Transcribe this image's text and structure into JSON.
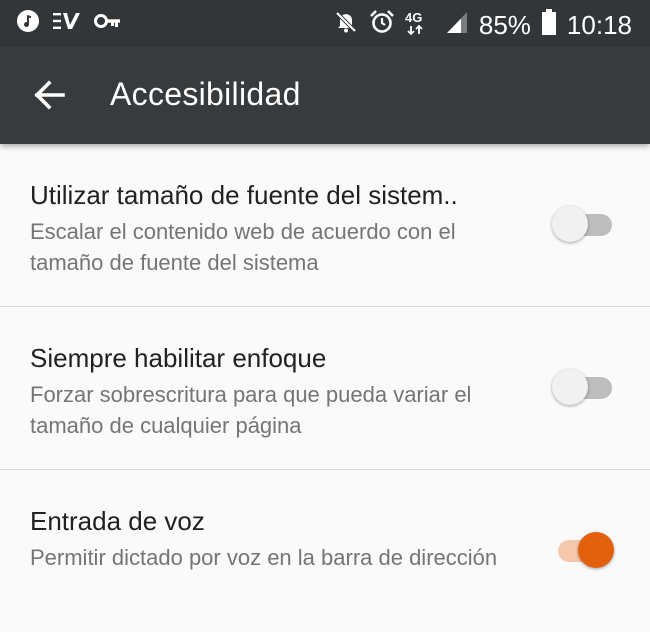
{
  "status_bar": {
    "battery_text": "85%",
    "time": "10:18",
    "network": "4G",
    "left_icons": [
      "music-icon",
      "ev-icon",
      "key-icon"
    ],
    "right_icons": [
      "mute-icon",
      "alarm-icon",
      "network-icon",
      "signal-icon",
      "battery-icon"
    ]
  },
  "app_bar": {
    "title": "Accesibilidad",
    "back_icon": "back-arrow-icon"
  },
  "settings": [
    {
      "title": "Utilizar tamaño de fuente del sistem..",
      "summary": "Escalar el contenido web de acuerdo con el tamaño de fuente del sistema",
      "enabled": false
    },
    {
      "title": "Siempre habilitar enfoque",
      "summary": "Forzar sobrescritura para que pueda variar el tamaño de cualquier página",
      "enabled": false
    },
    {
      "title": "Entrada de voz",
      "summary": "Permitir dictado por voz en la barra de dirección",
      "enabled": true
    }
  ],
  "colors": {
    "status_bar": "#333638",
    "app_bar": "#383b3d",
    "accent": "#e3600d",
    "accent_track": "#f6c8ab",
    "background": "#fafafa"
  }
}
